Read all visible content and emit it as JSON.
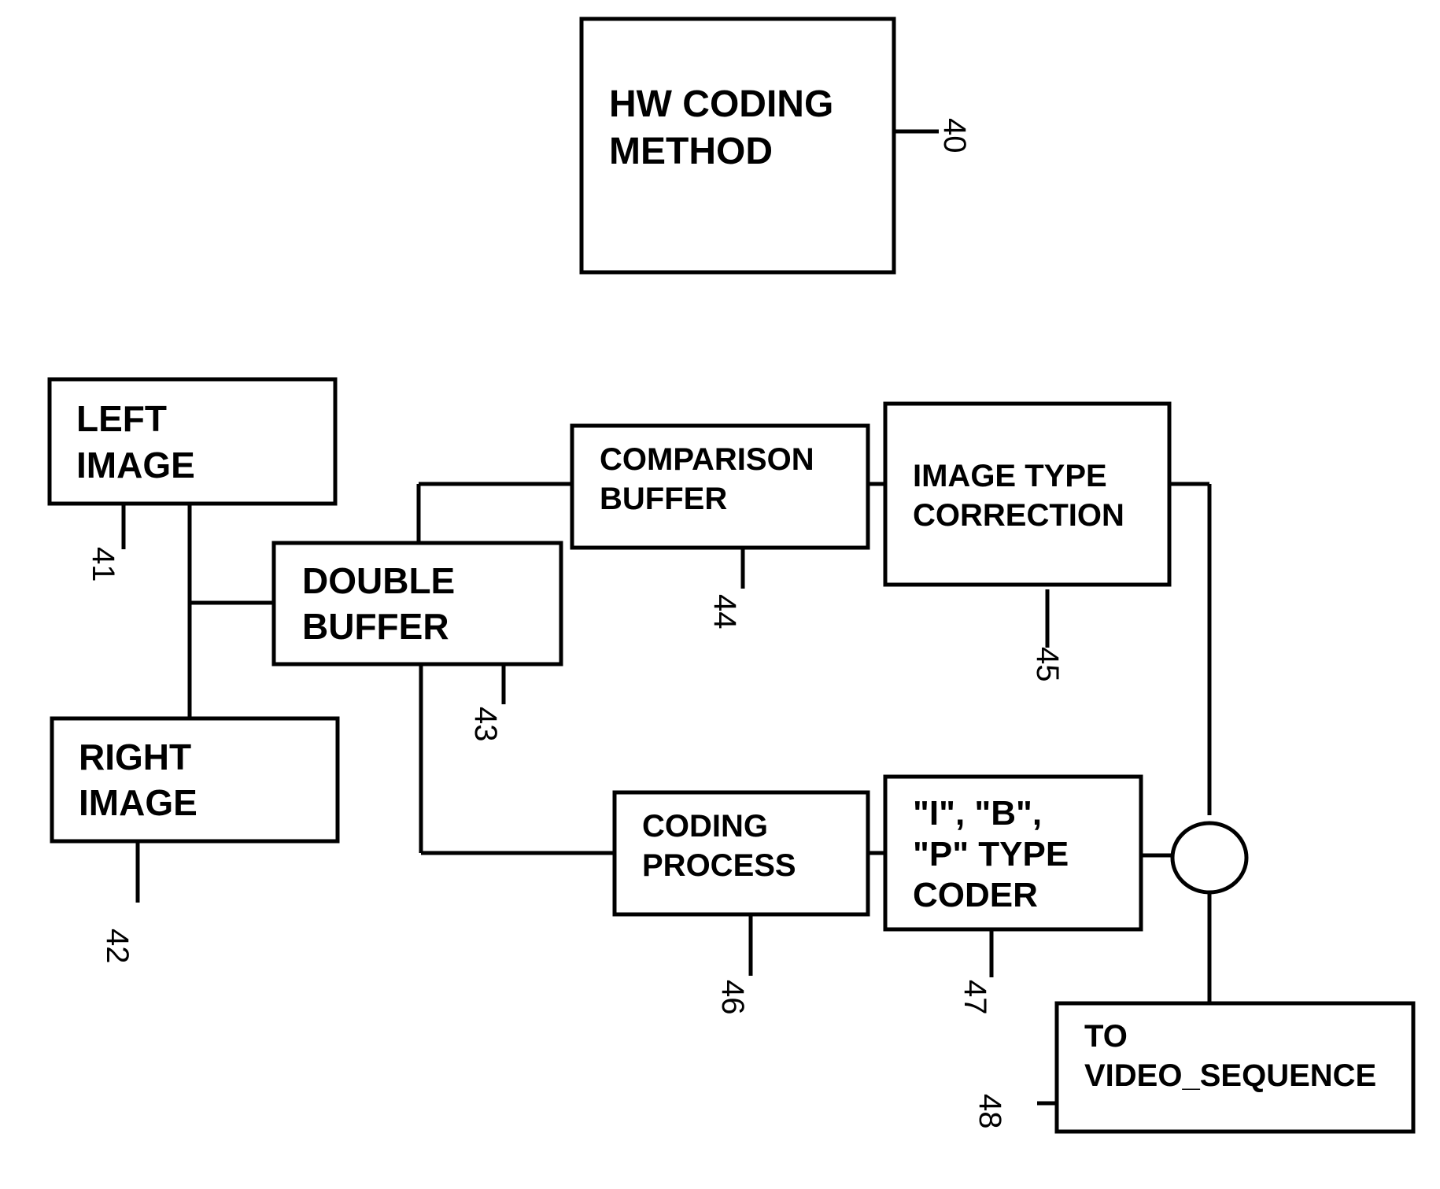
{
  "diagram": {
    "blocks": {
      "hw": {
        "lines": [
          "HW CODING",
          "METHOD"
        ],
        "ref": "40"
      },
      "left": {
        "lines": [
          "LEFT",
          "IMAGE"
        ],
        "ref": "41"
      },
      "right": {
        "lines": [
          "RIGHT",
          "IMAGE"
        ],
        "ref": "42"
      },
      "double": {
        "lines": [
          "DOUBLE",
          "BUFFER"
        ],
        "ref": "43"
      },
      "comparison": {
        "lines": [
          "COMPARISON",
          "BUFFER"
        ],
        "ref": "44"
      },
      "itc": {
        "lines": [
          "IMAGE TYPE",
          "CORRECTION"
        ],
        "ref": "45"
      },
      "coding": {
        "lines": [
          "CODING",
          "PROCESS"
        ],
        "ref": "46"
      },
      "ibp": {
        "lines": [
          "\"I\", \"B\",",
          "\"P\" TYPE",
          "CODER"
        ],
        "ref": "47"
      },
      "video": {
        "lines": [
          "TO",
          "VIDEO_SEQUENCE"
        ],
        "ref": "48"
      }
    }
  }
}
